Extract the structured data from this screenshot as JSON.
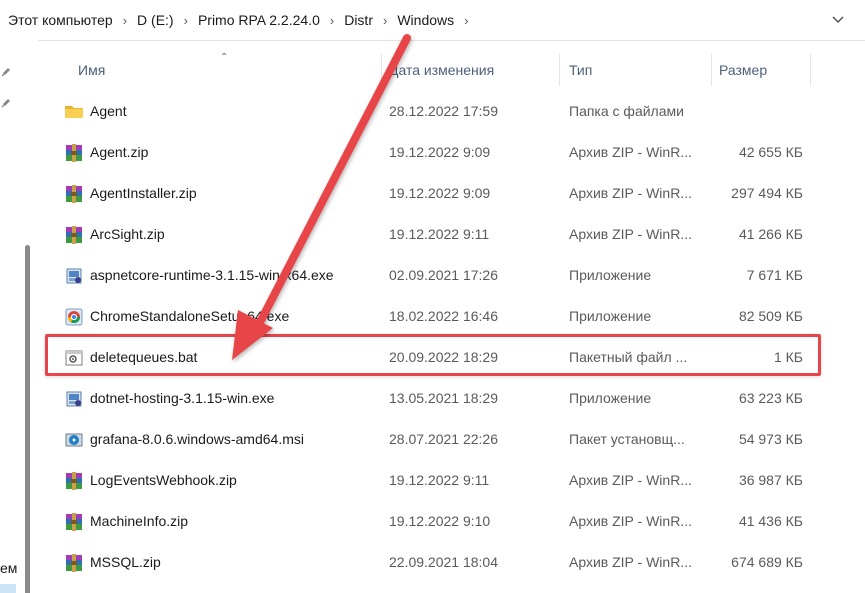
{
  "breadcrumb": {
    "items": [
      "Этот компьютер",
      "D (E:)",
      "Primo RPA 2.2.24.0",
      "Distr",
      "Windows"
    ],
    "separator": ">"
  },
  "nav": {
    "cut_text": "ем"
  },
  "columns": {
    "name": "Имя",
    "date": "Дата изменения",
    "type": "Тип",
    "size": "Размер"
  },
  "files": [
    {
      "name": "Agent",
      "date": "28.12.2022 17:59",
      "type": "Папка с файлами",
      "size": "",
      "icon": "folder-icon"
    },
    {
      "name": "Agent.zip",
      "date": "19.12.2022 9:09",
      "type": "Архив ZIP - WinR...",
      "size": "42 655 КБ",
      "icon": "winrar-archive-icon"
    },
    {
      "name": "AgentInstaller.zip",
      "date": "19.12.2022 9:09",
      "type": "Архив ZIP - WinR...",
      "size": "297 494 КБ",
      "icon": "winrar-archive-icon"
    },
    {
      "name": "ArcSight.zip",
      "date": "19.12.2022 9:11",
      "type": "Архив ZIP - WinR...",
      "size": "41 266 КБ",
      "icon": "winrar-archive-icon"
    },
    {
      "name": "aspnetcore-runtime-3.1.15-win-x64.exe",
      "date": "02.09.2021 17:26",
      "type": "Приложение",
      "size": "7 671 КБ",
      "icon": "installer-exe-icon"
    },
    {
      "name": "ChromeStandaloneSetup64.exe",
      "date": "18.02.2022 16:46",
      "type": "Приложение",
      "size": "82 509 КБ",
      "icon": "chrome-setup-icon"
    },
    {
      "name": "deletequeues.bat",
      "date": "20.09.2022 18:29",
      "type": "Пакетный файл ...",
      "size": "1 КБ",
      "icon": "batch-file-icon"
    },
    {
      "name": "dotnet-hosting-3.1.15-win.exe",
      "date": "13.05.2021 18:29",
      "type": "Приложение",
      "size": "63 223 КБ",
      "icon": "installer-exe-icon"
    },
    {
      "name": "grafana-8.0.6.windows-amd64.msi",
      "date": "28.07.2021 22:26",
      "type": "Пакет установщ...",
      "size": "54 973 КБ",
      "icon": "msi-package-icon"
    },
    {
      "name": "LogEventsWebhook.zip",
      "date": "19.12.2022 9:11",
      "type": "Архив ZIP - WinR...",
      "size": "36 987 КБ",
      "icon": "winrar-archive-icon"
    },
    {
      "name": "MachineInfo.zip",
      "date": "19.12.2022 9:10",
      "type": "Архив ZIP - WinR...",
      "size": "41 436 КБ",
      "icon": "winrar-archive-icon"
    },
    {
      "name": "MSSQL.zip",
      "date": "22.09.2021 18:04",
      "type": "Архив ZIP - WinR...",
      "size": "674 689 КБ",
      "icon": "winrar-archive-icon"
    }
  ],
  "highlighted_file": "deletequeues.bat",
  "colors": {
    "annotation_red": "#e8444a",
    "folder_yellow": "#f4c33d",
    "header_text": "#4c607a"
  }
}
